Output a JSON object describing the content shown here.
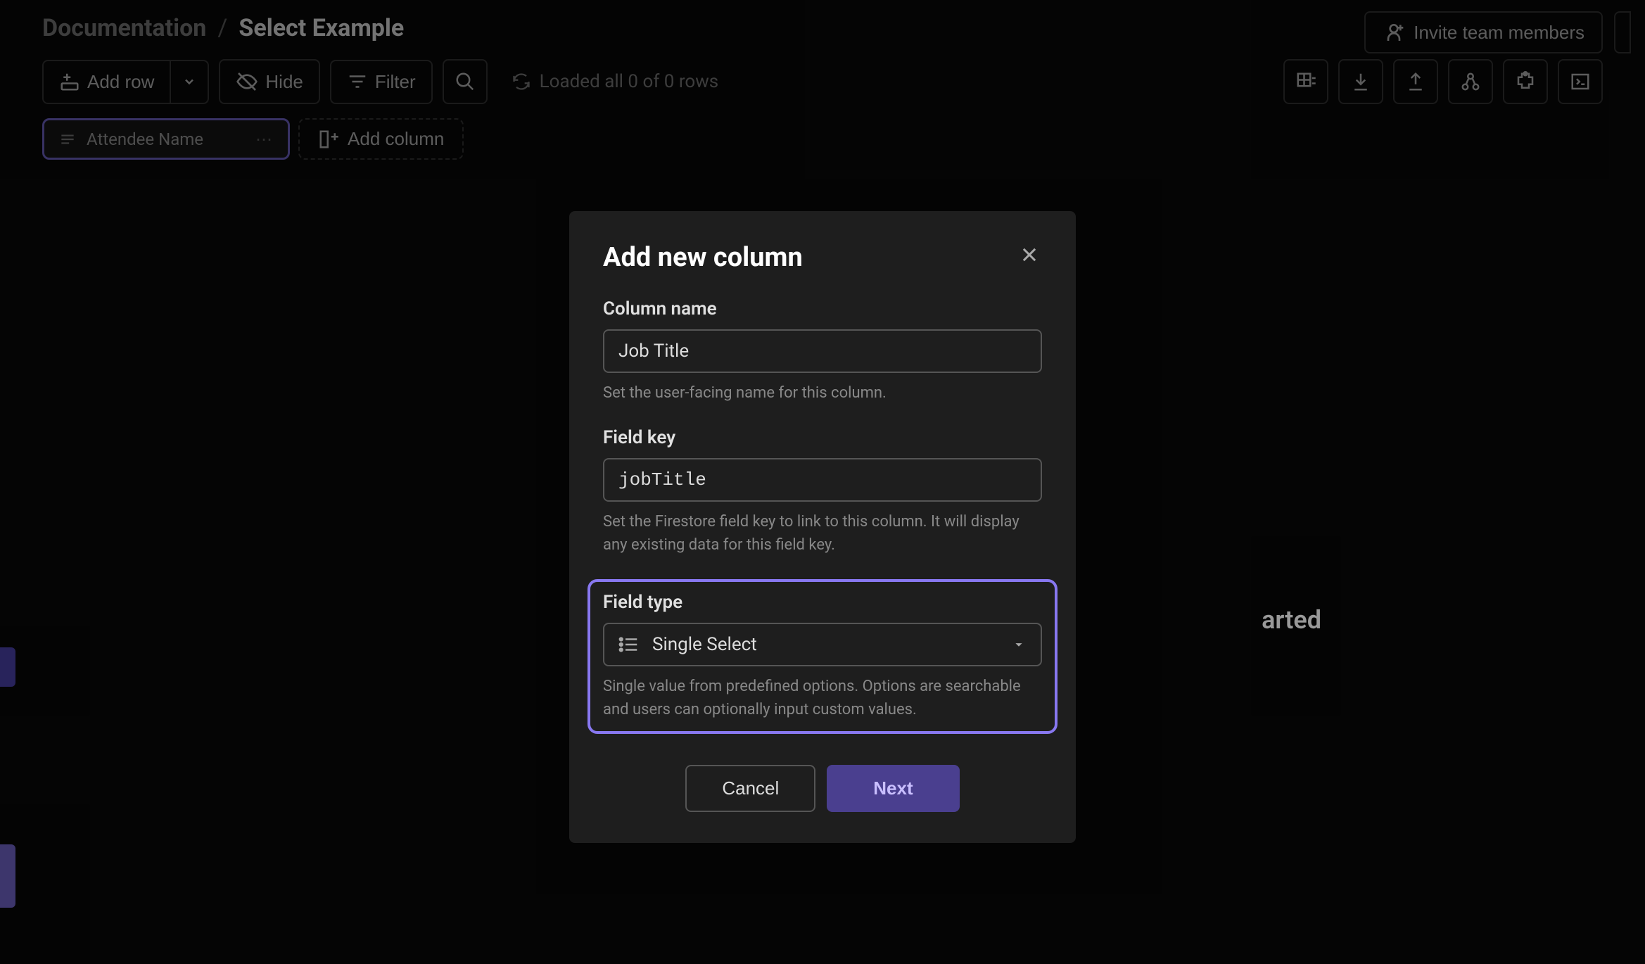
{
  "breadcrumb": {
    "root": "Documentation",
    "separator": "/",
    "current": "Select Example"
  },
  "header": {
    "invite_label": "Invite team members"
  },
  "toolbar": {
    "add_row": "Add row",
    "hide": "Hide",
    "filter": "Filter",
    "status": "Loaded all 0 of 0 rows"
  },
  "columns": {
    "first": "Attendee Name",
    "add_label": "Add column"
  },
  "background": {
    "hint_fragment": "arted"
  },
  "modal": {
    "title": "Add new column",
    "column_name_label": "Column name",
    "column_name_value": "Job Title",
    "column_name_help": "Set the user-facing name for this column.",
    "field_key_label": "Field key",
    "field_key_value": "jobTitle",
    "field_key_help": "Set the Firestore field key to link to this column. It will display any existing data for this field key.",
    "field_type_label": "Field type",
    "field_type_value": "Single Select",
    "field_type_help": "Single value from predefined options. Options are searchable and users can optionally input custom values.",
    "cancel": "Cancel",
    "next": "Next"
  }
}
